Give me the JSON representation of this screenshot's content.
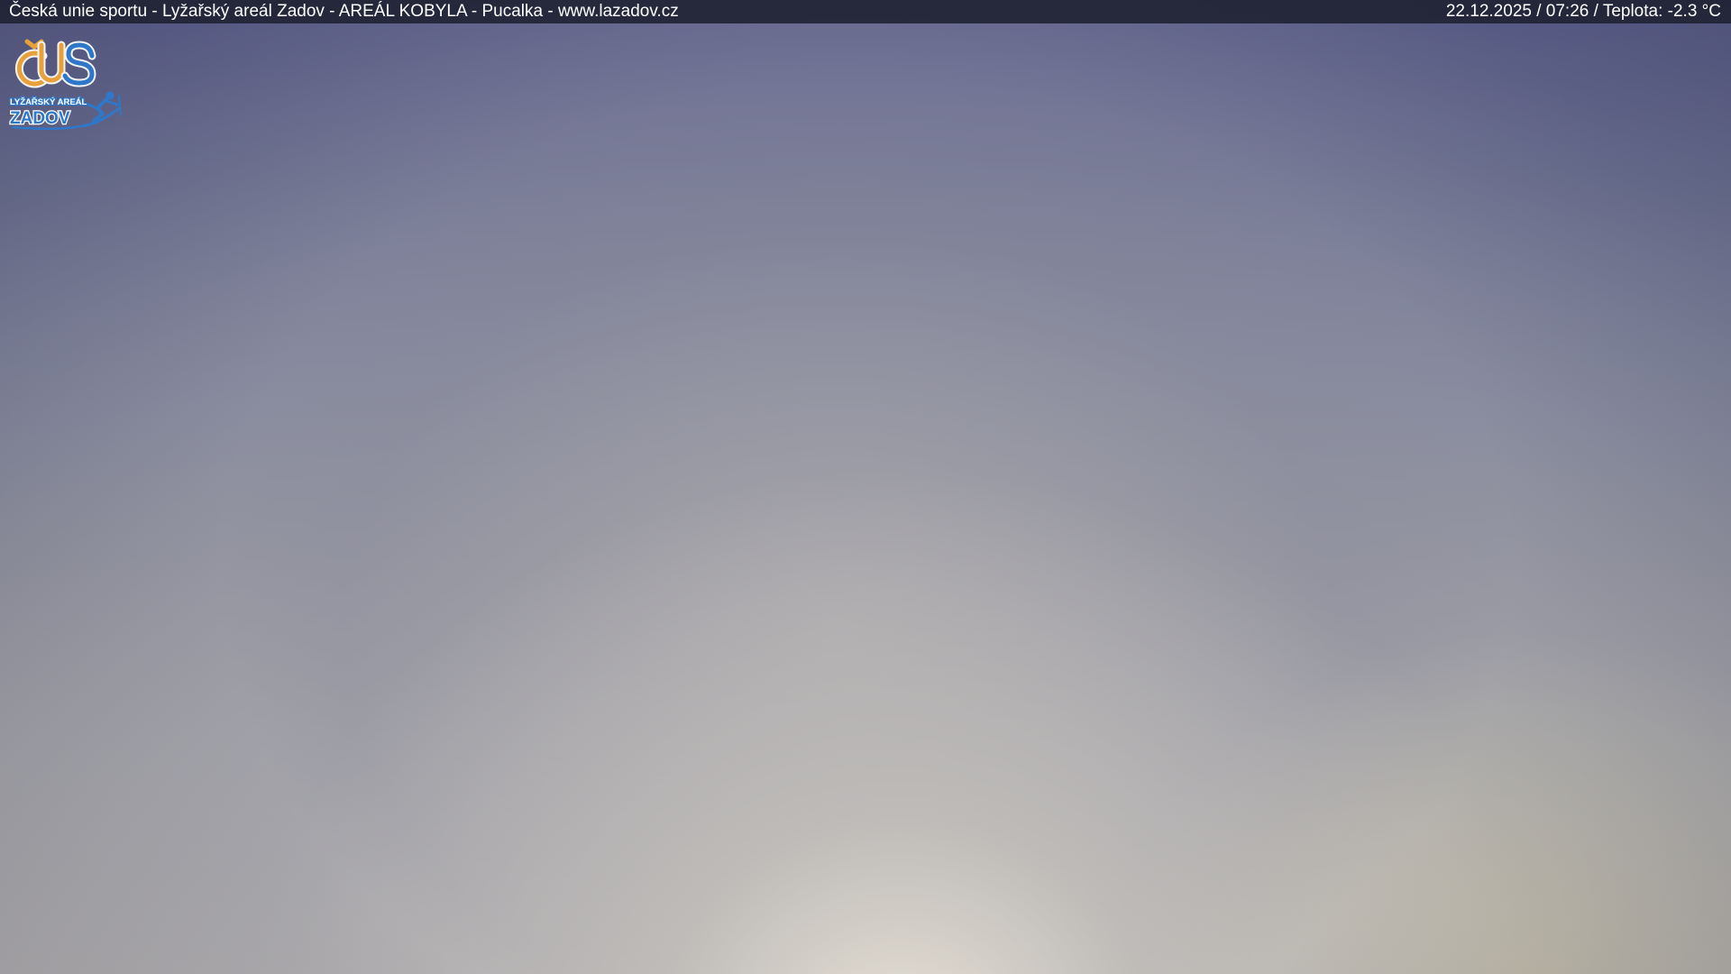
{
  "header": {
    "title": "Česká unie sportu - Lyžařský areál Zadov - AREÁL KOBYLA - Pucalka - www.lazadov.cz",
    "status": "22.12.2025 / 07:26 / Teplota: -2.3 °C"
  },
  "logo": {
    "monogram": "ČUS",
    "subtitle": "LYŽAŘSKÝ AREÁL",
    "name": "ZADOV",
    "colors": {
      "orange": "#e8a03a",
      "blue": "#2f77c8"
    }
  }
}
